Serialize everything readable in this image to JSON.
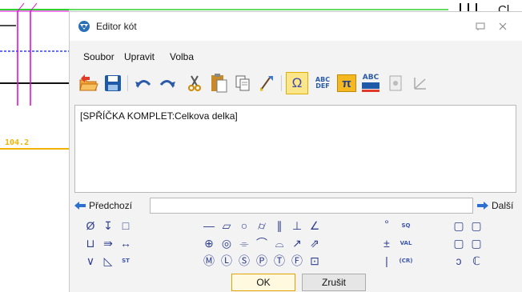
{
  "background": {
    "dimension_value": "104.2",
    "corner_text": "Cl"
  },
  "window": {
    "title": "Editor kót",
    "restore_icon": "restore-icon",
    "close_icon": "close-icon"
  },
  "menu": {
    "items": [
      "Soubor",
      "Upravit",
      "Volba"
    ]
  },
  "toolbar": {
    "abc_def_top": "ABC",
    "abc_def_bottom": "DEF",
    "abc_label": "ABC",
    "omega": "Ω",
    "pi": "π"
  },
  "editor": {
    "content": "[SPŘÍČKA KOMPLET:Celkova delka]"
  },
  "navigation": {
    "prev_label": "Předchozí",
    "next_label": "Další",
    "input_value": ""
  },
  "symbols": {
    "sq": "SQ",
    "st": "ST",
    "val": "VAL",
    "cr": "(CR)"
  },
  "buttons": {
    "ok": "OK",
    "cancel": "Zrušit"
  },
  "colors": {
    "accent_active": "#fde68a",
    "symbol_blue": "#2f3f8f",
    "cad_yellow": "#f0b400",
    "cad_magenta": "#e000e0"
  }
}
